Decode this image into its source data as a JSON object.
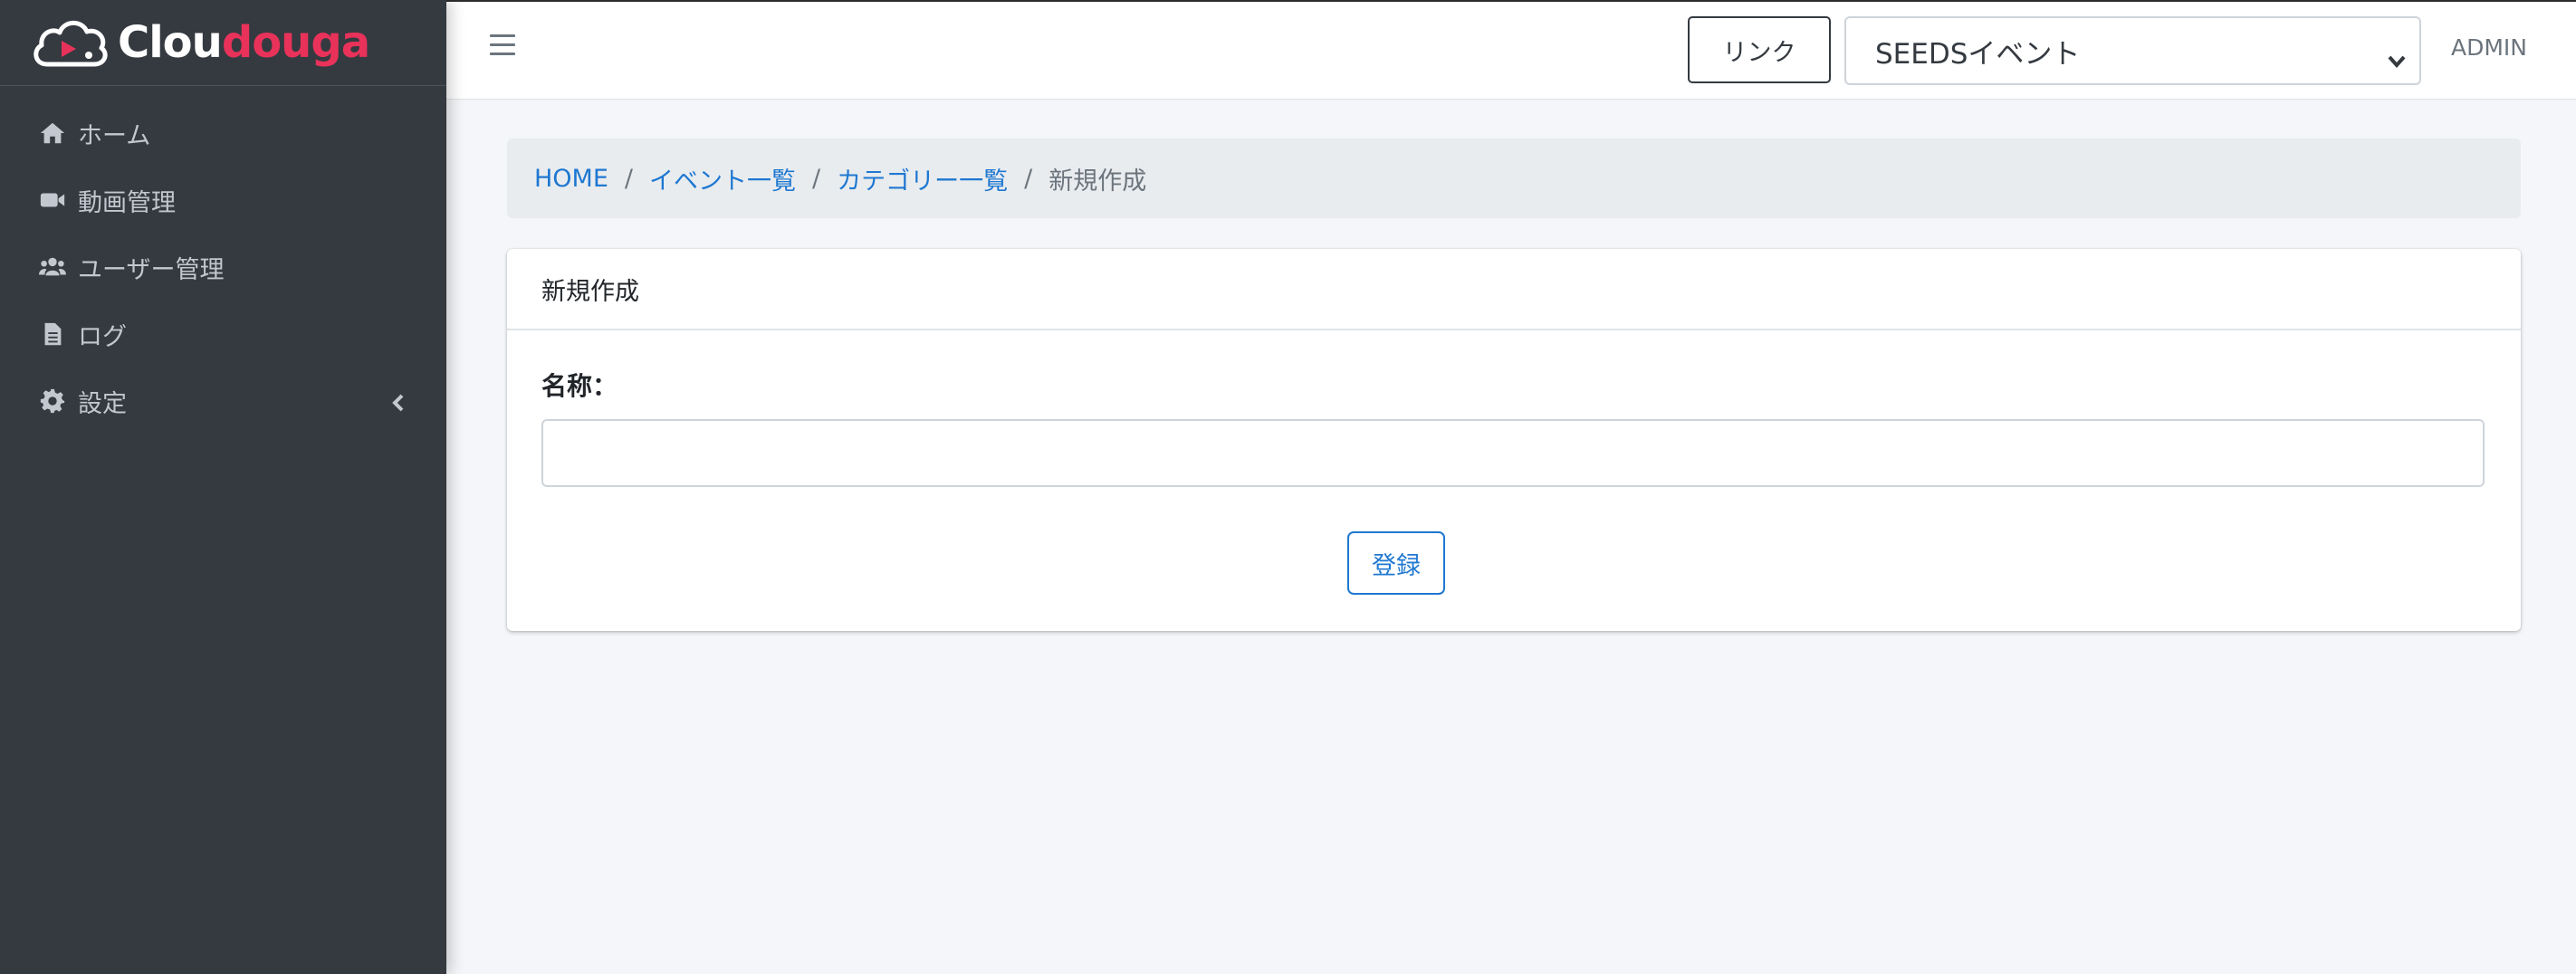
{
  "brand": {
    "name_part1": "Clou",
    "name_part2": "douga",
    "accent_color": "#e8325a"
  },
  "sidebar": {
    "items": [
      {
        "label": "ホーム",
        "icon": "home-icon"
      },
      {
        "label": "動画管理",
        "icon": "video-camera-icon"
      },
      {
        "label": "ユーザー管理",
        "icon": "users-icon"
      },
      {
        "label": "ログ",
        "icon": "file-icon"
      },
      {
        "label": "設定",
        "icon": "gear-icon",
        "has_submenu": true
      }
    ]
  },
  "topbar": {
    "link_label": "リンク",
    "event_select_value": "SEEDSイベント",
    "user_label": "ADMIN"
  },
  "breadcrumb": {
    "items": [
      "HOME",
      "イベント一覧",
      "カテゴリー一覧"
    ],
    "current": "新規作成"
  },
  "form": {
    "title": "新規作成",
    "name_label": "名称：",
    "name_value": "",
    "submit_label": "登録"
  },
  "colors": {
    "sidebar_bg": "#343a40",
    "link": "#1f78d1",
    "content_bg": "#f4f6f9"
  }
}
